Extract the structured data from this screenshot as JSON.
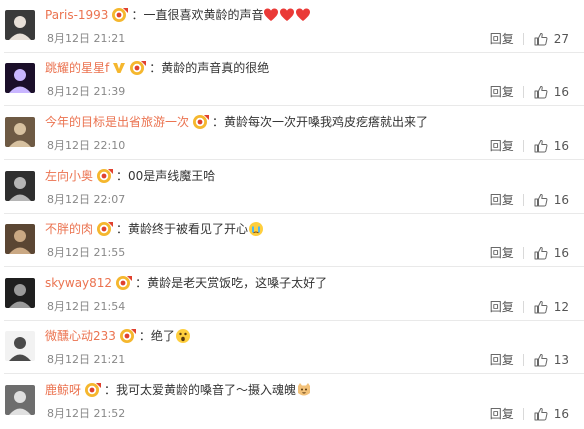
{
  "labels": {
    "reply": "回复"
  },
  "comments": [
    {
      "username": "Paris-1993",
      "colon": "：",
      "text": "一直很喜欢黄龄的声音",
      "time": "8月12日 21:21",
      "likes": "27",
      "trailing_emoji": [
        "heart",
        "heart",
        "heart"
      ],
      "avatar_colors": [
        "#3a3a3a",
        "#e8e0d8"
      ]
    },
    {
      "username": "跳耀的星星f",
      "colon": "：",
      "text": "黄龄的声音真的很绝",
      "time": "8月12日 21:39",
      "likes": "16",
      "vip_badge": true,
      "avatar_colors": [
        "#1b0f2a",
        "#c9b6ff"
      ]
    },
    {
      "username": "今年的目标是出省旅游一次",
      "colon": "：",
      "text": "黄龄每次一次开嗓我鸡皮疙瘩就出来了",
      "time": "8月12日 22:10",
      "likes": "16",
      "avatar_colors": [
        "#6e5a44",
        "#d7c1a0"
      ]
    },
    {
      "username": "左向小奥",
      "colon": "：",
      "text": "00是声线魔王哈",
      "time": "8月12日 22:07",
      "likes": "16",
      "avatar_colors": [
        "#2e2e2e",
        "#b5b5b5"
      ]
    },
    {
      "username": "不胖的肉",
      "colon": "：",
      "text": "黄龄终于被看见了开心",
      "time": "8月12日 21:55",
      "likes": "16",
      "trailing_emoji": [
        "tears"
      ],
      "avatar_colors": [
        "#5b4633",
        "#caa883"
      ]
    },
    {
      "username": "skyway812",
      "colon": "：",
      "text": "黄龄是老天赏饭吃，这嗓子太好了",
      "time": "8月12日 21:54",
      "likes": "12",
      "avatar_colors": [
        "#1f1f1f",
        "#9a9a9a"
      ]
    },
    {
      "username": "微醺心动233",
      "colon": "：",
      "text": "绝了",
      "time": "8月12日 21:21",
      "likes": "13",
      "trailing_emoji": [
        "shock"
      ],
      "avatar_colors": [
        "#f2f2f2",
        "#4a4a4a"
      ]
    },
    {
      "username": "鹿鲸呀",
      "colon": "：",
      "text": "我可太爱黄龄的嗓音了～摄入魂魄",
      "time": "8月12日 21:52",
      "likes": "16",
      "trailing_emoji": [
        "cat"
      ],
      "avatar_colors": [
        "#6d6d6d",
        "#e0e0e0"
      ]
    }
  ],
  "colors": {
    "username": "#eb7350",
    "meta": "#888888",
    "divider": "#e9e9e9",
    "badge_gold": "#f5b72e",
    "badge_red": "#e0412f",
    "heart": "#ea3a37"
  }
}
